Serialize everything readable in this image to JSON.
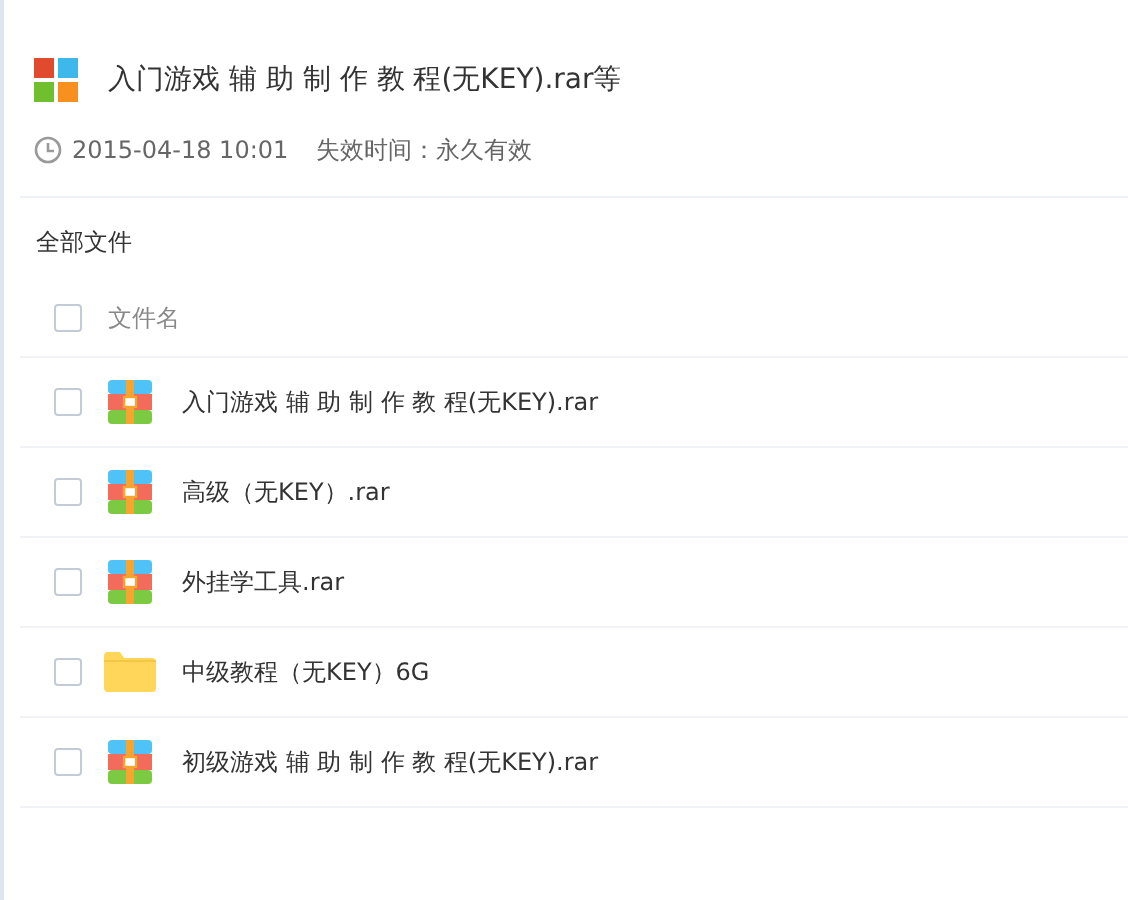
{
  "share": {
    "title": "入门游戏 辅 助 制 作 教 程(无KEY).rar等",
    "created": "2015-04-18 10:01",
    "expiry": "失效时间：永久有效"
  },
  "breadcrumb": "全部文件",
  "list_header": {
    "label": "文件名",
    "checked": false
  },
  "files": [
    {
      "name": "入门游戏 辅 助 制 作 教 程(无KEY).rar",
      "kind": "archive",
      "checked": false
    },
    {
      "name": "高级（无KEY）.rar",
      "kind": "archive",
      "checked": false
    },
    {
      "name": "外挂学工具.rar",
      "kind": "archive",
      "checked": false
    },
    {
      "name": "中级教程（无KEY）6G",
      "kind": "folder",
      "checked": false
    },
    {
      "name": "初级游戏 辅 助 制 作 教 程(无KEY).rar",
      "kind": "archive",
      "checked": false
    }
  ]
}
